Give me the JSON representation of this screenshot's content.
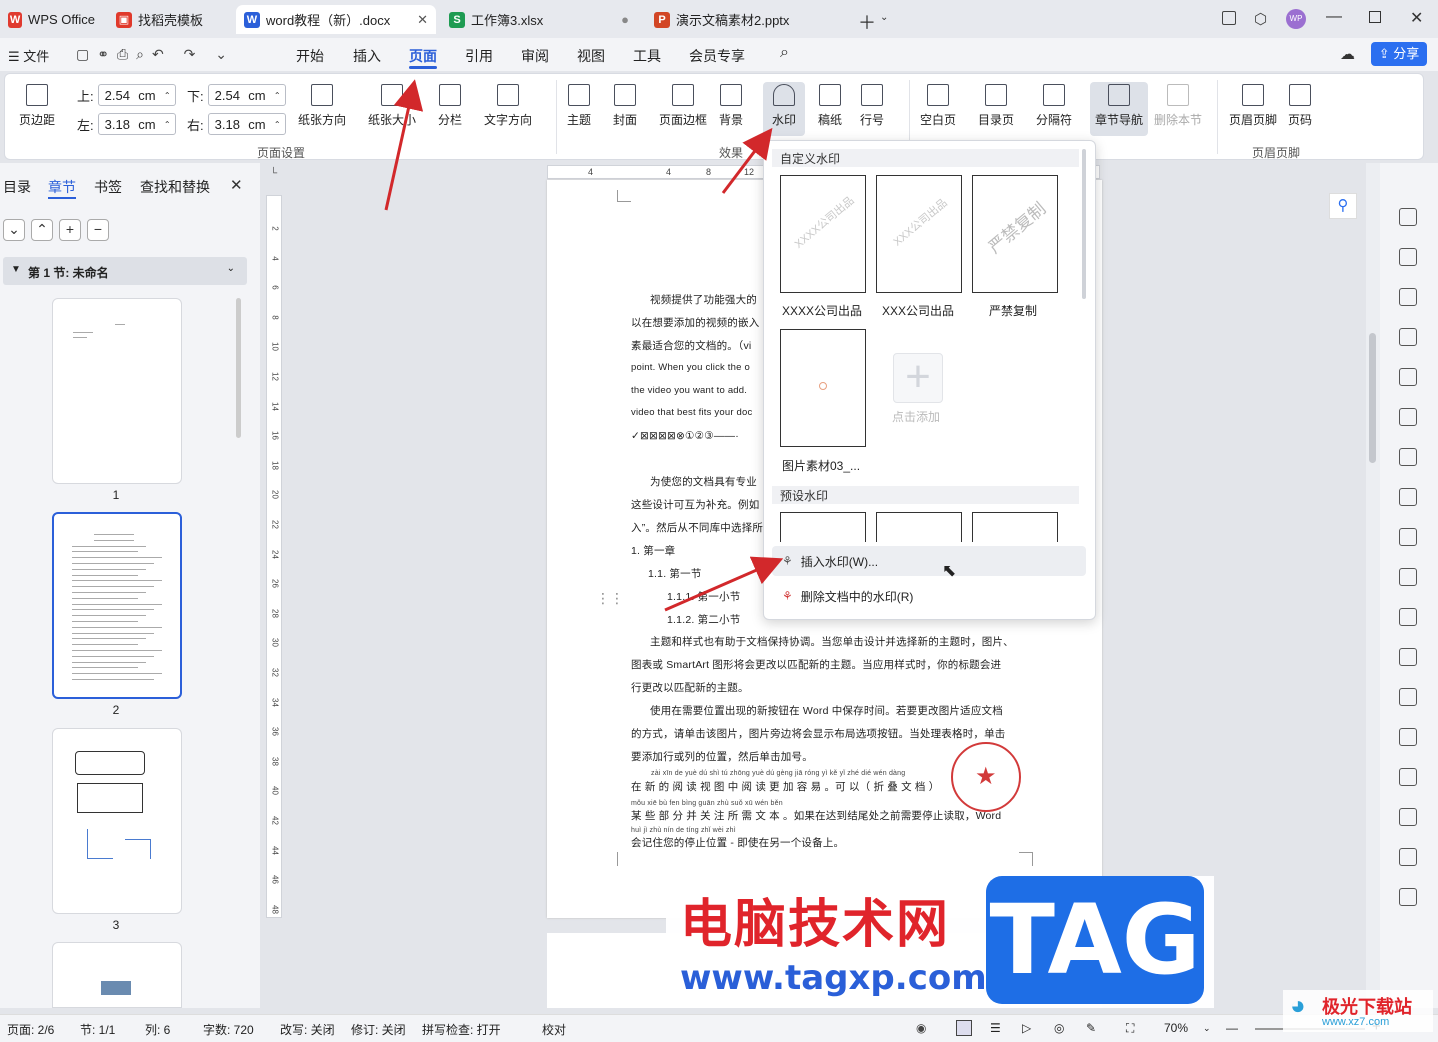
{
  "tabs": [
    {
      "label": "WPS Office",
      "icon": "wps-logo-icon"
    },
    {
      "label": "找稻壳模板",
      "icon": "docer-icon"
    },
    {
      "label": "word教程（新）.docx",
      "icon": "writer-icon"
    },
    {
      "label": "工作簿3.xlsx",
      "icon": "spreadsheet-icon"
    },
    {
      "label": "演示文稿素材2.pptx",
      "icon": "presentation-icon"
    }
  ],
  "menubar": {
    "file": "文件",
    "items": [
      "开始",
      "插入",
      "页面",
      "引用",
      "审阅",
      "视图",
      "工具",
      "会员专享"
    ],
    "active": "页面",
    "share": "分享"
  },
  "ribbon": {
    "margins": "页边距",
    "top_label": "上:",
    "top_value": "2.54",
    "bottom_label": "下:",
    "bottom_value": "2.54",
    "left_label": "左:",
    "left_value": "3.18",
    "right_label": "右:",
    "right_value": "3.18",
    "unit": "cm",
    "orientation": "纸张方向",
    "size": "纸张大小",
    "columns": "分栏",
    "text_direction": "文字方向",
    "group_page_setup": "页面设置",
    "theme": "主题",
    "cover": "封面",
    "page_border": "页面边框",
    "background": "背景",
    "watermark": "水印",
    "draft": "稿纸",
    "line_numbers": "行号",
    "group_effects": "效果",
    "blank_page": "空白页",
    "toc_page": "目录页",
    "separator": "分隔符",
    "section_nav": "章节导航",
    "delete_section": "删除本节",
    "header_footer": "页眉页脚",
    "page_number": "页码",
    "group_header_footer": "页眉页脚"
  },
  "left_panel": {
    "tabs": [
      "目录",
      "章节",
      "书签",
      "查找和替换"
    ],
    "active_tab": "章节",
    "section_title": "第 1 节: 未命名",
    "thumb_labels": [
      "1",
      "2",
      "3"
    ]
  },
  "document": {
    "lines": [
      "视频提供了功能强大的",
      "以在想要添加的视频的嵌入",
      "素最适合您的文档的。（vi",
      "point. When you click the o",
      "the video you want to add.",
      "video that best fits your doc",
      "✓⊠⊠⊠⊠⊗①②③——·",
      "为使您的文档具有专业",
      "这些设计可互为补充。例如",
      "入”。然后从不同库中选择所",
      "1.   第一章",
      "1.1. 第一节",
      "1.1.1.    第一小节",
      "1.1.2.    第二小节",
      "主题和样式也有助于文档保持协调。当您单击设计并选择新的主题时，图片、",
      "图表或 SmartArt 图形将会更改以匹配新的主题。当应用样式时，你的标题会进",
      "行更改以匹配新的主题。",
      "使用在需要位置出现的新按钮在 Word 中保存时间。若要更改图片适应文档",
      "的方式，请单击该图片，图片旁边将会显示布局选项按钮。当处理表格时，单击",
      "要添加行或列的位置，然后单击加号。",
      "在 新 的 阅 读 视 图 中 阅 读 更 加 容 易 。可 以（ 折  叠 文 档 ）",
      "某 些 部 分 并 关 注 所 需 文 本 。如果在达到结尾处之前需要停止读取，Word",
      "会记住您的停止位置 - 即使在另一个设备上。"
    ],
    "pinyin_1": "zài xīn de yuè dú shì tú zhōng yuè dú gèng jiā róng yì   kě yǐ   zhé   dié wén dàng",
    "pinyin_2": "mǒu xiē bù fen bìng guān zhù suǒ xū wén běn",
    "pinyin_3": "huì jì zhù nín de tíng zhǐ wèi zhì"
  },
  "watermark_panel": {
    "custom_title": "自定义水印",
    "cards": [
      {
        "text": "XXXX公司出品",
        "name": "XXXX公司出品"
      },
      {
        "text": "XXX公司出品",
        "name": "XXX公司出品"
      },
      {
        "text": "严禁复制",
        "name": "严禁复制"
      },
      {
        "text": "",
        "name": "图片素材03_..."
      }
    ],
    "add_label": "点击添加",
    "preset_title": "预设水印",
    "insert_label": "插入水印(W)...",
    "delete_label": "删除文档中的水印(R)"
  },
  "status": {
    "page": "页面: 2/6",
    "section": "节: 1/1",
    "column": "列: 6",
    "words": "字数: 720",
    "revise": "改写: 关闭",
    "track": "修订: 关闭",
    "spell": "拼写检查: 打开",
    "proof": "校对",
    "zoom": "70%"
  },
  "overlay": {
    "site_name": "电脑技术网",
    "site_url": "www.tagxp.com",
    "tag": "TAG",
    "corner_brand": "极光下载站",
    "corner_url": "www.xz7.com"
  },
  "ruler": {
    "h_ticks": [
      "4",
      "4",
      "8",
      "12"
    ],
    "v_ticks": [
      "2",
      "4",
      "6",
      "8",
      "10",
      "12",
      "14",
      "16",
      "18",
      "20",
      "22",
      "24",
      "26",
      "28",
      "30",
      "32",
      "34",
      "36",
      "38",
      "40",
      "42",
      "44",
      "46",
      "48"
    ]
  },
  "colors": {
    "accent": "#2b5fd9",
    "wps_red": "#e03a2f",
    "annotation": "#d2282b",
    "tag_blue": "#1e6ee6"
  }
}
